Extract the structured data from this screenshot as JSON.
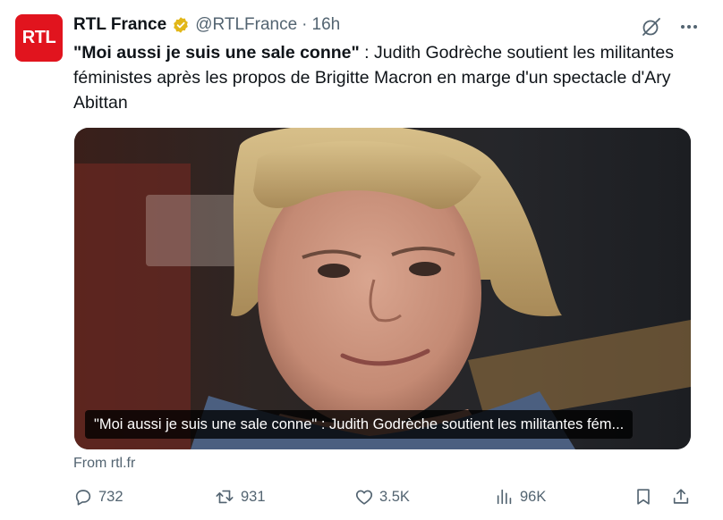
{
  "account": {
    "logo_text": "RTL",
    "display_name": "RTL France",
    "handle": "@RTLFrance",
    "separator": "·",
    "time": "16h"
  },
  "tweet": {
    "bold_quote": "\"Moi aussi je suis une sale conne\"",
    "body": " : Judith Godrèche soutient les militantes féministes après les propos de Brigitte Macron en marge d'un spectacle d'Ary Abittan"
  },
  "card": {
    "caption": "\"Moi aussi je suis une sale conne\" : Judith Godrèche soutient les militantes fém...",
    "source": "From rtl.fr"
  },
  "actions": {
    "replies": "732",
    "reposts": "931",
    "likes": "3.5K",
    "views": "96K"
  },
  "colors": {
    "brand_red": "#e1141e",
    "verified_gold": "#e2b719",
    "muted": "#536471",
    "text": "#0f1419"
  },
  "icons": [
    "verified-badge-icon",
    "grok-icon",
    "more-icon",
    "reply-icon",
    "repost-icon",
    "like-icon",
    "views-icon",
    "bookmark-icon",
    "share-icon"
  ]
}
